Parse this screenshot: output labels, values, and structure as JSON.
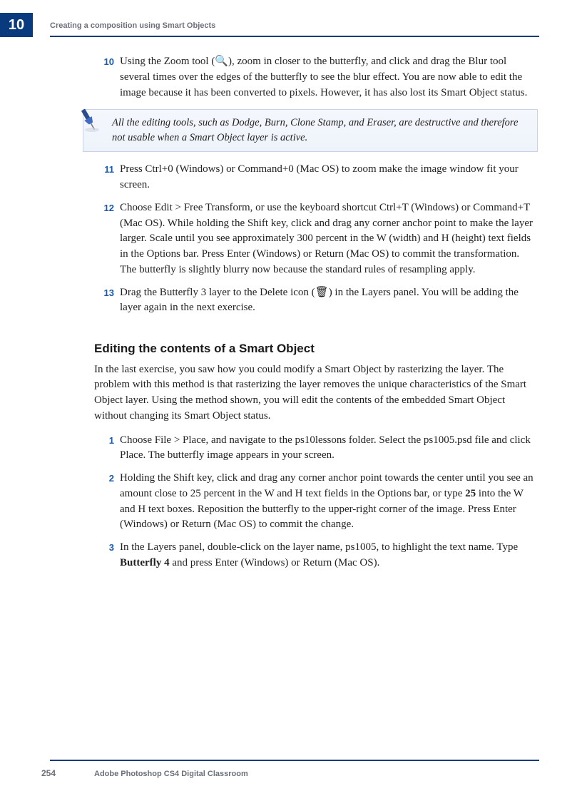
{
  "chapter_number": "10",
  "running_head": "Creating a composition using Smart Objects",
  "steps_a": [
    {
      "num": "10",
      "text": "Using the Zoom tool (🔍), zoom in closer to the butterfly, and click and drag the Blur tool several times over the edges of the butterfly to see the blur effect. You are now able to edit the image because it has been converted to pixels. However, it has also lost its Smart Object status."
    }
  ],
  "note_text": "All the editing tools, such as Dodge, Burn, Clone Stamp, and Eraser, are destructive and therefore not usable when a Smart Object layer is active.",
  "steps_b": [
    {
      "num": "11",
      "text": "Press Ctrl+0 (Windows) or Command+0 (Mac OS) to zoom make the image window fit your screen."
    },
    {
      "num": "12",
      "text": "Choose Edit > Free Transform, or use the keyboard shortcut Ctrl+T (Windows) or Command+T (Mac OS). While holding the Shift key, click and drag any corner anchor point to make the layer larger. Scale until you see approximately 300 percent in the W (width) and H (height) text fields in the Options bar. Press Enter (Windows) or Return (Mac OS) to commit the transformation. The butterfly is slightly blurry now because the standard rules of resampling apply."
    },
    {
      "num": "13",
      "text": "Drag the Butterfly 3 layer to the Delete icon (🗑) in the Layers panel. You will be adding the layer again in the next exercise."
    }
  ],
  "section_heading": "Editing the contents of a Smart Object",
  "section_intro": "In the last exercise, you saw how you could modify a Smart Object by rasterizing the layer. The problem with this method is that rasterizing the layer removes the unique characteristics of the Smart Object layer. Using the method shown, you will edit the contents of the embedded Smart Object without changing its Smart Object status.",
  "steps_c": [
    {
      "num": "1",
      "text": "Choose File > Place, and navigate to the ps10lessons folder. Select the ps1005.psd file and click Place. The butterfly image appears in your screen."
    },
    {
      "num": "2",
      "html": "Holding the Shift key, click and drag any corner anchor point towards the center until you see an amount close to 25 percent in the W and H text fields in the Options bar, or type <b class='ui'>25</b> into the W and H text boxes. Reposition the butterfly to the upper-right corner of the image. Press Enter (Windows) or Return (Mac OS) to commit the change."
    },
    {
      "num": "3",
      "html": "In the Layers panel, double-click on the layer name, ps1005, to highlight the text name. Type <b class='ui'>Butterfly 4</b> and press Enter (Windows) or Return (Mac OS)."
    }
  ],
  "page_number": "254",
  "book_title": "Adobe Photoshop CS4 Digital Classroom"
}
